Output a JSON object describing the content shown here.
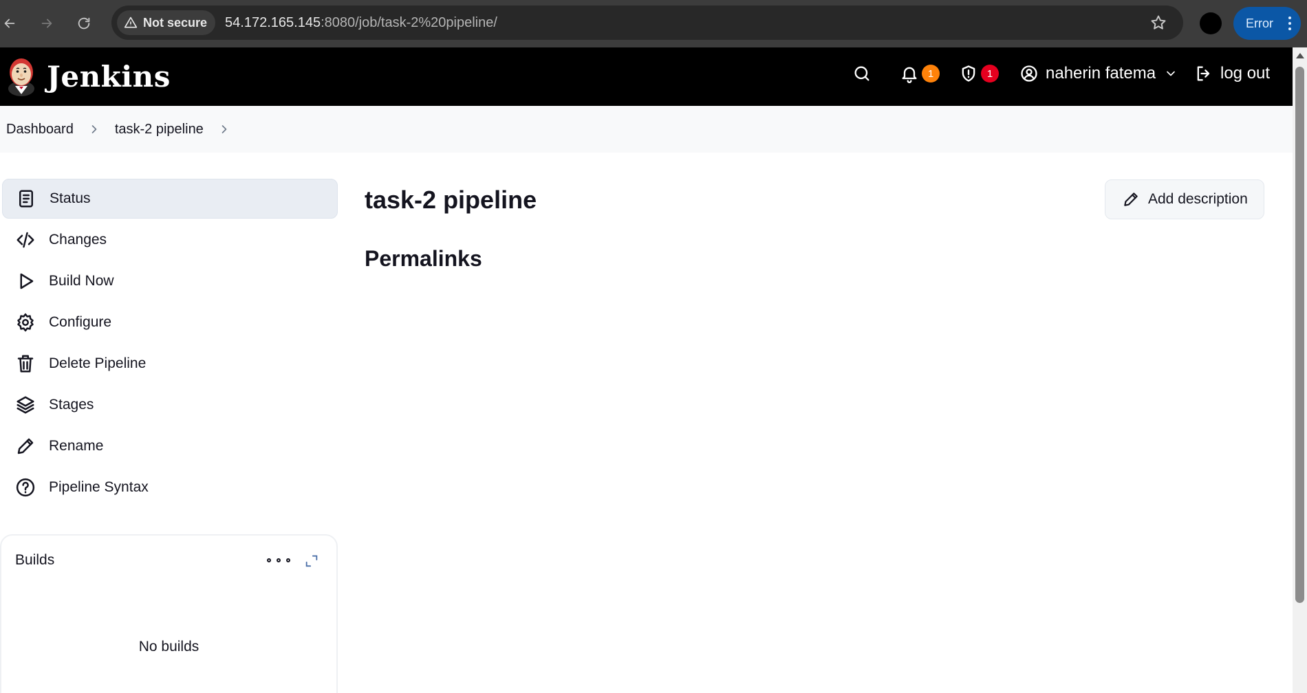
{
  "browser": {
    "security_label": "Not secure",
    "url_host": "54.172.165.145",
    "url_rest": ":8080/job/task-2%20pipeline/",
    "error_label": "Error"
  },
  "header": {
    "app_name": "Jenkins",
    "notifications_count": "1",
    "security_count": "1",
    "user_name": "naherin fatema",
    "logout_label": "log out"
  },
  "breadcrumb": {
    "items": [
      "Dashboard",
      "task-2 pipeline"
    ]
  },
  "sidebar": {
    "items": [
      {
        "label": "Status",
        "icon": "status-icon"
      },
      {
        "label": "Changes",
        "icon": "code-icon"
      },
      {
        "label": "Build Now",
        "icon": "play-icon"
      },
      {
        "label": "Configure",
        "icon": "gear-icon"
      },
      {
        "label": "Delete Pipeline",
        "icon": "trash-icon"
      },
      {
        "label": "Stages",
        "icon": "layers-icon"
      },
      {
        "label": "Rename",
        "icon": "pencil-icon"
      },
      {
        "label": "Pipeline Syntax",
        "icon": "help-icon"
      }
    ]
  },
  "builds": {
    "title": "Builds",
    "empty_text": "No builds"
  },
  "main": {
    "title": "task-2 pipeline",
    "add_description_label": "Add description",
    "permalinks_title": "Permalinks"
  },
  "colors": {
    "header_bg": "#000000",
    "active_item_bg": "#e9edf3",
    "notification_badge": "#fe820a",
    "security_badge": "#e6001f"
  }
}
